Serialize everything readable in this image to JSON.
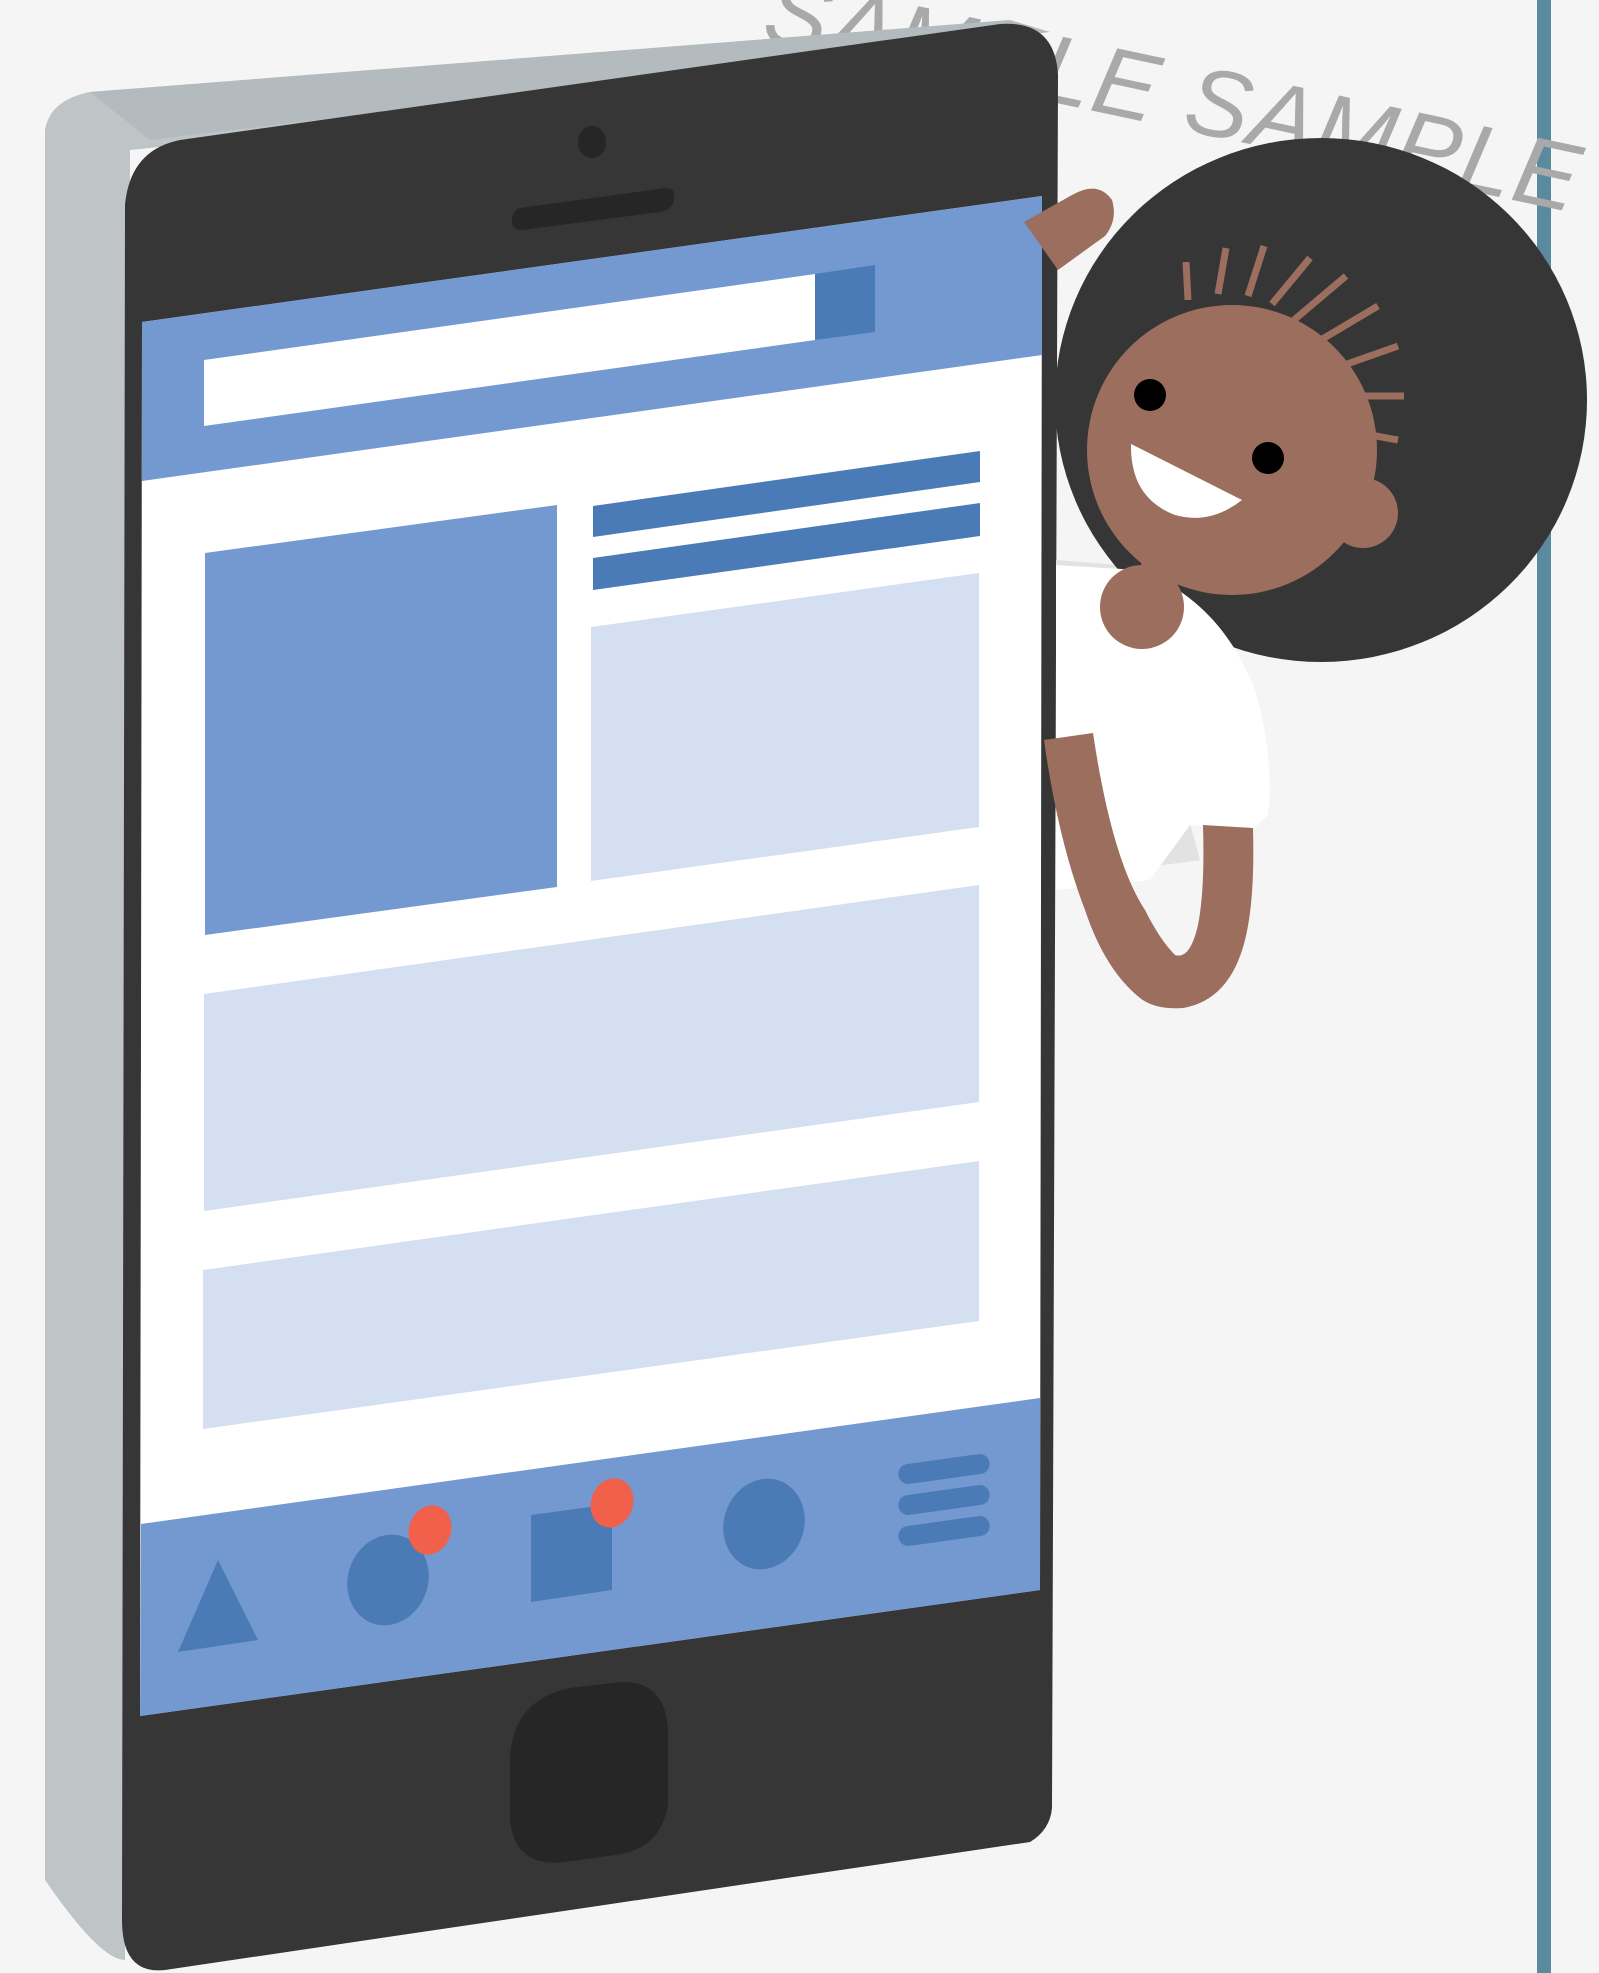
{
  "watermark": {
    "text": "SAMPLE SAMPLE SAMPLE"
  },
  "colors": {
    "background": "#f5f5f5",
    "phone_body": "#363636",
    "phone_edge": "#bfc4c7",
    "screen_accent": "#7399d0",
    "screen_dark_accent": "#4a7bb7",
    "screen_light": "#d4e0f1",
    "screen_white": "#ffffff",
    "notification_dot": "#f0604a",
    "skin": "#9b6e5d",
    "hair": "#363636",
    "vertical_rule": "#5a8a9e"
  },
  "icons": [
    "triangle-icon",
    "circle-icon",
    "square-icon",
    "circle-icon",
    "menu-icon"
  ],
  "notification_badges": 2
}
